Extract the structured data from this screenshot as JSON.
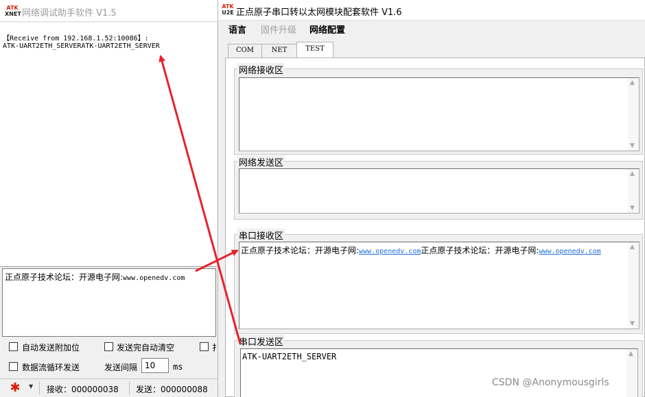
{
  "left_window": {
    "logo": {
      "line1": "ATK",
      "line2": "XNET"
    },
    "title": "网络调试助手软件 V1.5",
    "receive_header": "【Receive from  192.168.1.52:10086】:",
    "receive_data": "ATK-UART2ETH_SERVERATK-UART2ETH_SERVER",
    "send_text_cn": "正点原子技术论坛：开源电子网:",
    "send_text_url": "www.openedv.com",
    "options": {
      "auto_append": "自动发送附加位",
      "auto_clear": "发送完自动清空",
      "loop_send": "数据流循环发送",
      "cut_label": "扌"
    },
    "interval_label": "发送间隔",
    "interval_value": "10",
    "interval_unit": "ms",
    "status": {
      "recv_label": "接收：",
      "recv_count": "000000038",
      "send_label": "发送：",
      "send_count": "000000088"
    }
  },
  "right_window": {
    "logo": {
      "line1": "ATK",
      "line2": "U2E"
    },
    "title": "正点原子串口转以太网模块配套软件 V1.6",
    "menu": {
      "language": "语言",
      "firmware": "固件升级",
      "network": "网络配置"
    },
    "tabs": [
      "COM",
      "NET",
      "TEST"
    ],
    "groups": {
      "net_recv": "网络接收区",
      "net_send": "网络发送区",
      "serial_recv": "串口接收区",
      "serial_send": "串口发送区"
    },
    "serial_recv": {
      "part1": "正点原子技术论坛：开源电子网:",
      "link1": "www.openedv.com",
      "part2": "正点原子技术论坛：开源电子网:",
      "link2": "www.openedv.com"
    },
    "serial_send_text": "ATK-UART2ETH_SERVER"
  },
  "watermark": "CSDN @Anonymousgirls",
  "colors": {
    "arrow": "#e8212a",
    "logo_red": "#d81e06",
    "link": "#1e6bd6"
  }
}
